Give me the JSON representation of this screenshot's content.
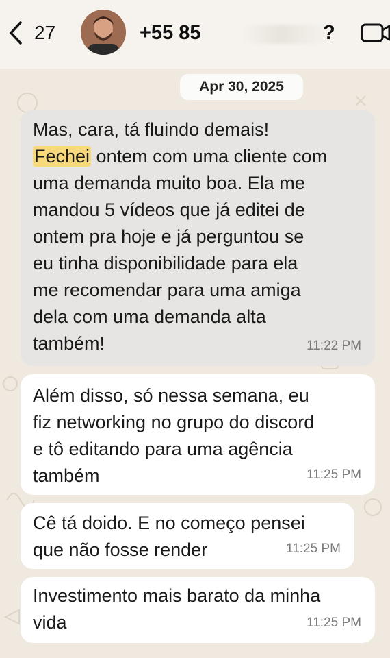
{
  "header": {
    "back_count": "27",
    "contact_name_visible": "+55 85",
    "contact_name_tail": "?",
    "video_icon": "video-call-icon",
    "back_icon": "chevron-left-icon"
  },
  "date_separator": "Apr 30, 2025",
  "messages": [
    {
      "highlight": "Fechei",
      "pre": "Mas, cara, tá fluindo demais!\n",
      "text": " ontem com uma cliente com\numa demanda muito boa. Ela me\nmandou 5 vídeos que já editei de\nontem pra hoje e já perguntou se\neu tinha disponibilidade para ela\nme recomendar para uma amiga\ndela com uma demanda alta\ntambém!",
      "time": "11:22 PM"
    },
    {
      "text": "Além disso, só nessa semana, eu\nfiz networking no grupo do discord\ne tô editando para uma agência\ntambém",
      "time": "11:25 PM"
    },
    {
      "text": "Cê tá doido. E no começo pensei\nque não fosse render",
      "time": "11:25 PM"
    },
    {
      "text": "Investimento mais barato da minha\nvida",
      "time": "11:25 PM"
    }
  ],
  "colors": {
    "background": "#efe9df",
    "header": "#f6f3ee",
    "bubble": "#ffffff",
    "bubble_selected": "#e6e5e3",
    "highlight": "#f7d87b"
  }
}
